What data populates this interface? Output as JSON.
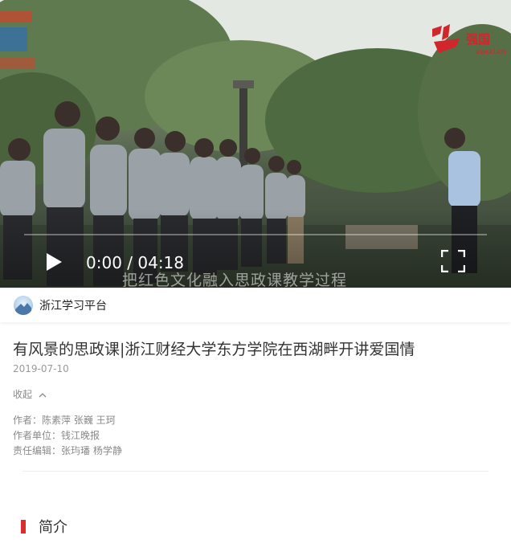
{
  "video": {
    "overlay_caption": "把红色文化融入思政课教学过程",
    "watermark_text": "强国",
    "watermark_sub": "xuexi.cn",
    "time_display": "0:00 / 04:18"
  },
  "channel": {
    "name": "浙江学习平台"
  },
  "article": {
    "title": "有风景的思政课|浙江财经大学东方学院在西湖畔开讲爱国情",
    "date": "2019-07-10",
    "collapse_label": "收起",
    "author_line": "作者：陈素萍 张巍 王珂",
    "org_line": "作者单位：钱江晚报",
    "editor_line": "责任编辑：张玙璠 杨学静"
  },
  "intro": {
    "label": "简介"
  },
  "colors": {
    "accent_red": "#e02b2b",
    "watermark_red": "#d0262c"
  },
  "icons": [
    "play-icon",
    "fullscreen-icon",
    "chevron-up-icon",
    "channel-avatar"
  ]
}
